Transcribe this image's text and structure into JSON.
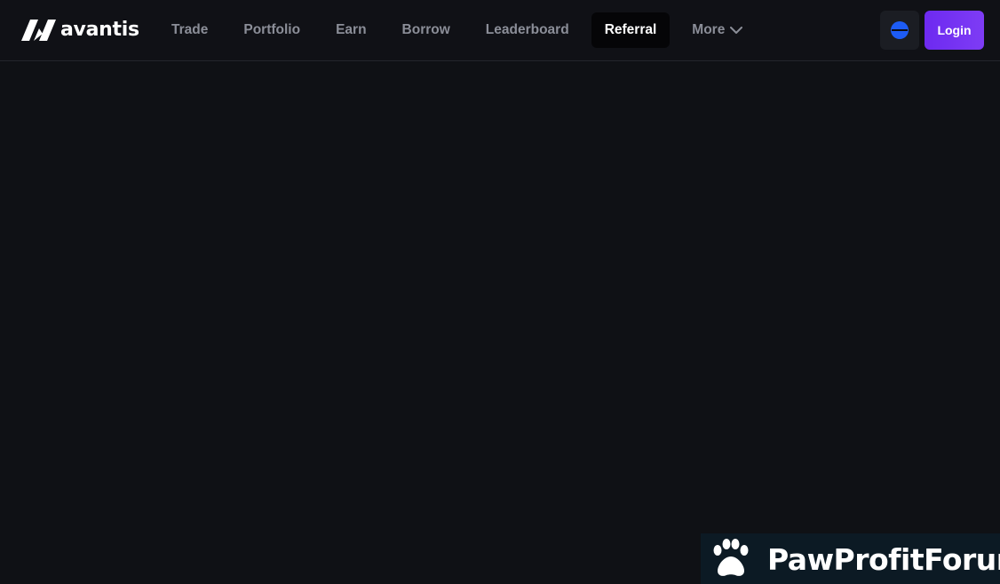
{
  "brand": {
    "name": "avantis"
  },
  "nav": {
    "items": [
      {
        "label": "Trade"
      },
      {
        "label": "Portfolio"
      },
      {
        "label": "Earn"
      },
      {
        "label": "Borrow"
      },
      {
        "label": "Leaderboard"
      },
      {
        "label": "Referral",
        "active": true
      },
      {
        "label": "More"
      }
    ]
  },
  "header_actions": {
    "network_icon": "network-globe-icon",
    "login_label": "Login"
  },
  "watermark": {
    "text": "PawProfitForum",
    "icon": "paw-icon"
  },
  "colors": {
    "background": "#0f1115",
    "active_nav_bg": "#050507",
    "login_gradient_start": "#6d2af0",
    "login_gradient_end": "#7e3cf5",
    "network_icon": "#1d5cf5",
    "watermark_bg": "#0c1a24"
  }
}
